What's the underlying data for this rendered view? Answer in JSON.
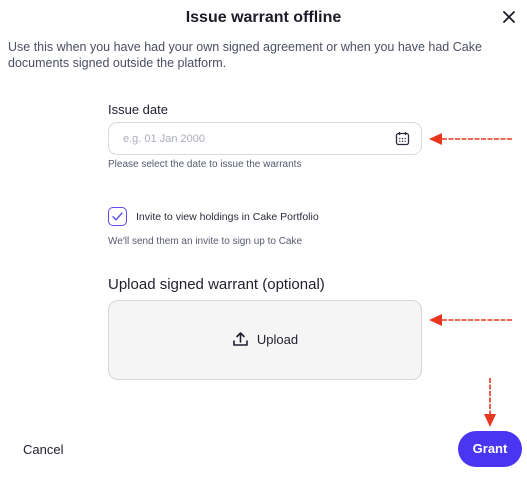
{
  "dialog": {
    "title": "Issue warrant offline",
    "description": "Use this when you have had your own signed agreement or when you have had Cake documents signed outside the platform."
  },
  "issue_date": {
    "label": "Issue date",
    "placeholder": "e.g. 01 Jan 2000",
    "value": "",
    "helper": "Please select the date to issue the warrants",
    "icon": "calendar-icon"
  },
  "invite": {
    "checked": true,
    "label": "Invite to view holdings in Cake Portfolio",
    "helper": "We'll send them an invite to sign up to Cake"
  },
  "upload": {
    "section_title": "Upload signed warrant (optional)",
    "button_label": "Upload",
    "icon": "upload-icon"
  },
  "footer": {
    "cancel_label": "Cancel",
    "grant_label": "Grant"
  },
  "colors": {
    "accent": "#4a36f2",
    "annotation_arrow": "#e8361f"
  }
}
